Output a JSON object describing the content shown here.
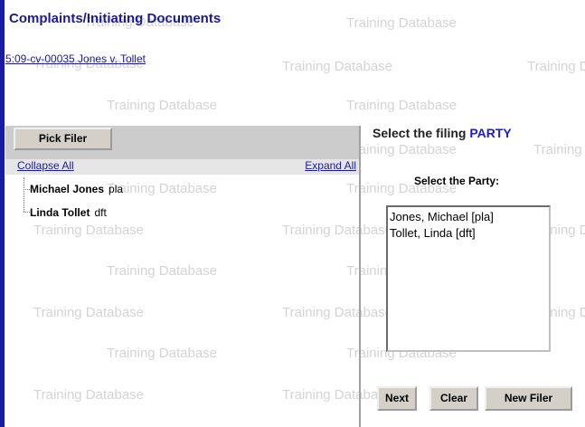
{
  "page": {
    "title": "Complaints/Initiating Documents",
    "case_link": "5:09-cv-00035 Jones v. Tollet",
    "watermark": "Training Database"
  },
  "left_panel": {
    "pick_filer_label": "Pick Filer",
    "collapse_all": "Collapse All",
    "expand_all": "Expand All",
    "tree": [
      {
        "name": "Michael Jones",
        "role": "pla"
      },
      {
        "name": "Linda Tollet",
        "role": "dft"
      }
    ]
  },
  "right_panel": {
    "title_prefix": "Select the filing",
    "title_highlight": "PARTY",
    "party_label": "Select the Party:",
    "party_options": [
      "Jones, Michael  [pla]",
      "Tollet, Linda  [dft]"
    ],
    "next_label": "Next",
    "clear_label": "Clear",
    "new_filer_label": "New Filer"
  },
  "colors": {
    "link": "#1a1aa8",
    "title": "#1a1a99",
    "party_highlight": "#1a1ae0",
    "panel_header": "#cccccc",
    "watermark": "#d4d4d4"
  }
}
